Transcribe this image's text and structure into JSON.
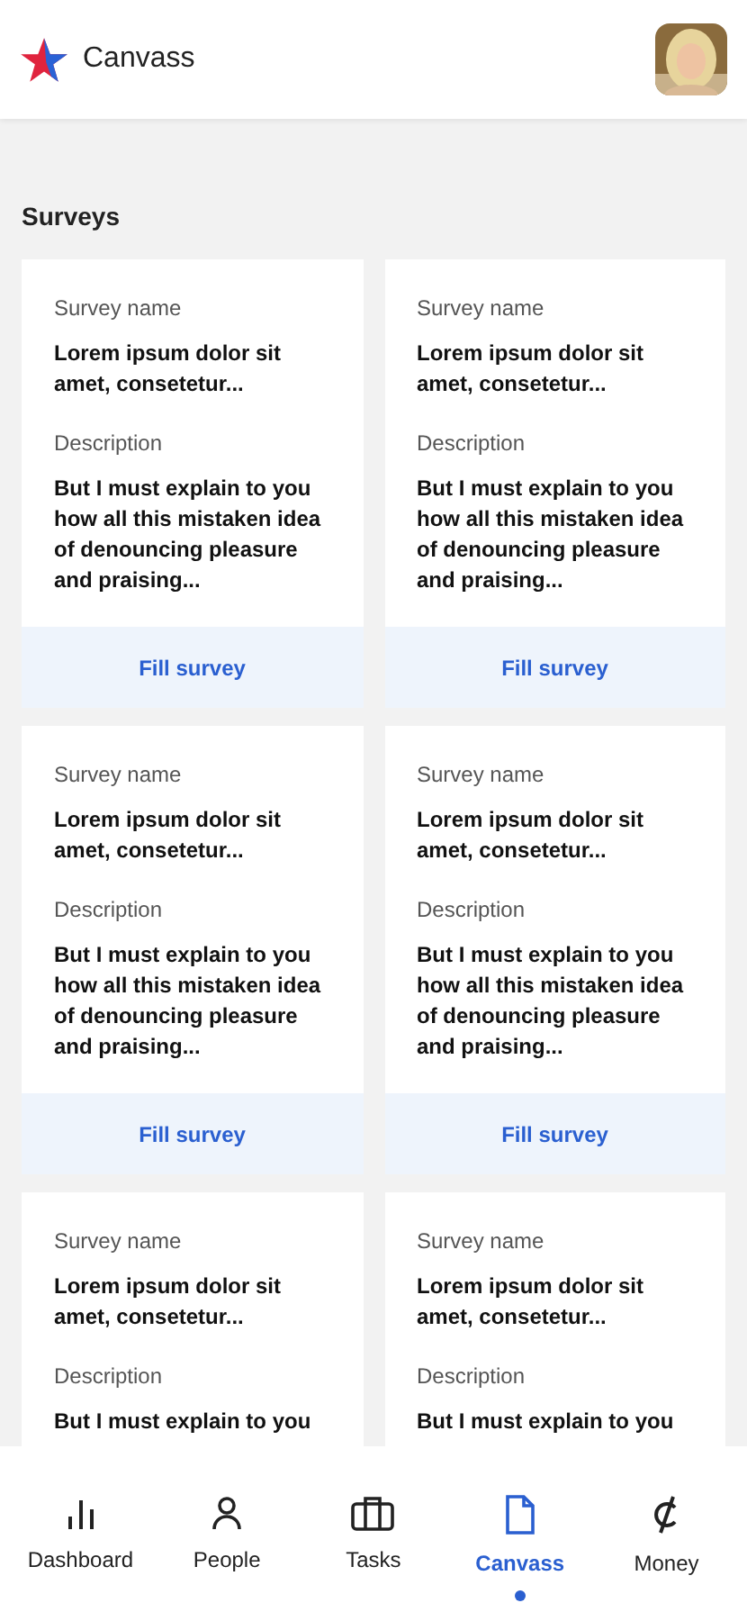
{
  "app": {
    "title": "Canvass"
  },
  "section_title": "Surveys",
  "surveys": [
    {
      "name_label": "Survey name",
      "name": "Lorem ipsum dolor sit amet, consetetur...",
      "description_label": "Description",
      "description": "But I must explain to you how all this mistaken idea of denouncing pleasure and praising...",
      "action": "Fill survey"
    },
    {
      "name_label": "Survey name",
      "name": "Lorem ipsum dolor sit amet, consetetur...",
      "description_label": "Description",
      "description": "But I must explain to you how all this mistaken idea of denouncing pleasure and praising...",
      "action": "Fill survey"
    },
    {
      "name_label": "Survey name",
      "name": "Lorem ipsum dolor sit amet, consetetur...",
      "description_label": "Description",
      "description": "But I must explain to you how all this mistaken idea of denouncing pleasure and praising...",
      "action": "Fill survey"
    },
    {
      "name_label": "Survey name",
      "name": "Lorem ipsum dolor sit amet, consetetur...",
      "description_label": "Description",
      "description": "But I must explain to you how all this mistaken idea of denouncing pleasure and praising...",
      "action": "Fill survey"
    },
    {
      "name_label": "Survey name",
      "name": "Lorem ipsum dolor sit amet, consetetur...",
      "description_label": "Description",
      "description": "But I must explain to you"
    },
    {
      "name_label": "Survey name",
      "name": "Lorem ipsum dolor sit amet, consetetur...",
      "description_label": "Description",
      "description": "But I must explain to you"
    }
  ],
  "nav": [
    {
      "kind": "dashboard",
      "label": "Dashboard",
      "selected": false
    },
    {
      "kind": "people",
      "label": "People",
      "selected": false
    },
    {
      "kind": "tasks",
      "label": "Tasks",
      "selected": false
    },
    {
      "kind": "canvass",
      "label": "Canvass",
      "selected": true
    },
    {
      "kind": "money",
      "label": "Money",
      "selected": false
    }
  ]
}
